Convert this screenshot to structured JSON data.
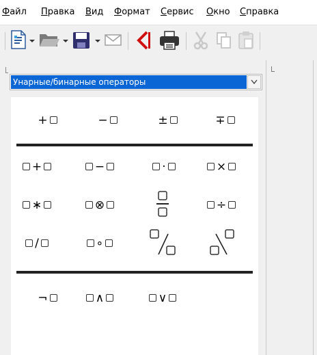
{
  "menu": {
    "items": [
      "Файл",
      "Правка",
      "Вид",
      "Формат",
      "Сервис",
      "Окно",
      "Справка"
    ]
  },
  "toolbar": {
    "buttons": [
      "new-document-icon",
      "open-folder-icon",
      "save-icon",
      "mail-icon",
      "export-pdf-icon",
      "print-icon",
      "cut-icon",
      "copy-icon",
      "paste-icon"
    ]
  },
  "elements_panel": {
    "category": "Унарные/бинарные операторы",
    "unary": [
      {
        "name": "plus",
        "op": "+"
      },
      {
        "name": "minus",
        "op": "−"
      },
      {
        "name": "plus-minus",
        "op": "±"
      },
      {
        "name": "minus-plus",
        "op": "∓"
      }
    ],
    "binary_row1": [
      {
        "name": "add",
        "op": "+"
      },
      {
        "name": "subtract",
        "op": "−"
      },
      {
        "name": "cdot",
        "op": "·"
      },
      {
        "name": "times",
        "op": "×"
      }
    ],
    "binary_row2": [
      {
        "name": "asterisk",
        "op": "∗"
      },
      {
        "name": "otimes",
        "op": "⊗"
      },
      {
        "name": "fraction",
        "op": ""
      },
      {
        "name": "divide",
        "op": "÷"
      }
    ],
    "binary_row3": [
      {
        "name": "slash",
        "op": "/"
      },
      {
        "name": "circ",
        "op": "∘"
      },
      {
        "name": "wide-slash",
        "op": ""
      },
      {
        "name": "wide-backslash",
        "op": ""
      }
    ],
    "logic": [
      {
        "name": "not",
        "op": "¬"
      },
      {
        "name": "and",
        "op": "∧"
      },
      {
        "name": "or",
        "op": "∨"
      }
    ]
  },
  "colors": {
    "selection": "#0a66d4",
    "panel_bg": "#f0f0f0",
    "palette_bg": "#ffffff"
  }
}
